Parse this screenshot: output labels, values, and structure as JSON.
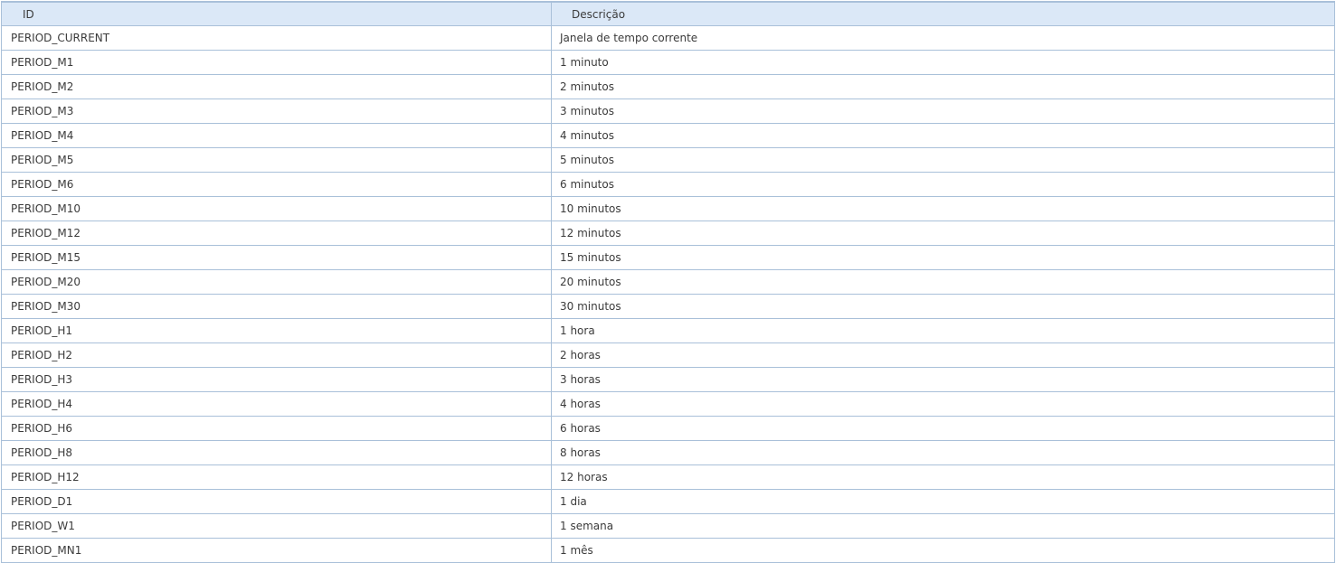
{
  "table": {
    "columns": [
      "ID",
      "Descrição"
    ],
    "rows": [
      [
        "PERIOD_CURRENT",
        "Janela de tempo corrente"
      ],
      [
        "PERIOD_M1",
        "1 minuto"
      ],
      [
        "PERIOD_M2",
        "2 minutos"
      ],
      [
        "PERIOD_M3",
        "3 minutos"
      ],
      [
        "PERIOD_M4",
        "4 minutos"
      ],
      [
        "PERIOD_M5",
        "5 minutos"
      ],
      [
        "PERIOD_M6",
        "6 minutos"
      ],
      [
        "PERIOD_M10",
        "10 minutos"
      ],
      [
        "PERIOD_M12",
        "12 minutos"
      ],
      [
        "PERIOD_M15",
        "15 minutos"
      ],
      [
        "PERIOD_M20",
        "20 minutos"
      ],
      [
        "PERIOD_M30",
        "30 minutos"
      ],
      [
        "PERIOD_H1",
        "1 hora"
      ],
      [
        "PERIOD_H2",
        "2 horas"
      ],
      [
        "PERIOD_H3",
        "3 horas"
      ],
      [
        "PERIOD_H4",
        "4 horas"
      ],
      [
        "PERIOD_H6",
        "6 horas"
      ],
      [
        "PERIOD_H8",
        "8 horas"
      ],
      [
        "PERIOD_H12",
        "12 horas"
      ],
      [
        "PERIOD_D1",
        "1 dia"
      ],
      [
        "PERIOD_W1",
        "1 semana"
      ],
      [
        "PERIOD_MN1",
        "1 mês"
      ]
    ]
  },
  "colors": {
    "header_background": "#dbe8f7",
    "border": "#a9c0d9",
    "text": "#3b3b3b"
  }
}
